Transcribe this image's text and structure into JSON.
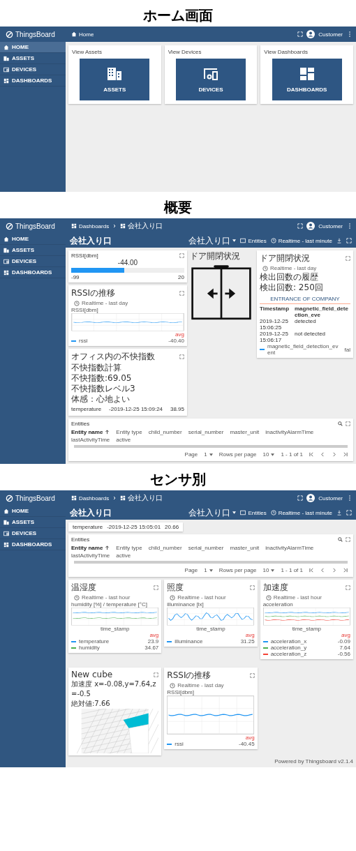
{
  "screens": [
    {
      "kind": "home",
      "heading": "ホーム画面",
      "logo": "ThingsBoard",
      "user": "Customer",
      "sidebar": [
        {
          "label": "HOME",
          "selected": true
        },
        {
          "label": "ASSETS",
          "selected": false
        },
        {
          "label": "DEVICES",
          "selected": false
        },
        {
          "label": "DASHBOARDS",
          "selected": false
        }
      ],
      "breadcrumbs": [
        "Home"
      ],
      "cards": [
        {
          "title": "View Assets",
          "button": "ASSETS"
        },
        {
          "title": "View Devices",
          "button": "DEVICES"
        },
        {
          "title": "View Dashboards",
          "button": "DASHBOARDS"
        }
      ]
    },
    {
      "kind": "overview",
      "heading": "概要",
      "logo": "ThingsBoard",
      "user": "Customer",
      "sidebar": [
        {
          "label": "HOME",
          "selected": false
        },
        {
          "label": "ASSETS",
          "selected": false
        },
        {
          "label": "DEVICES",
          "selected": false
        },
        {
          "label": "DASHBOARDS",
          "selected": false
        }
      ],
      "breadcrumbs": [
        "Dashboards",
        "会社入り口"
      ],
      "toolbar": {
        "title": "会社入り口",
        "state": "会社入り口",
        "entities": "Entities",
        "timewindow": "Realtime - last minute"
      },
      "gauge": {
        "title": "RSSI[dbm]",
        "value": "-44.00",
        "level": 0.47,
        "min": "-99",
        "max": "20"
      },
      "rssi_chart": {
        "title": "RSSIの推移",
        "timewindow": "Realtime - last day",
        "ylabel": "RSSI[dbm]",
        "legend_header": "avg",
        "legend": [
          {
            "name": "rssi",
            "value": "-40.40",
            "color": "#2196f3"
          }
        ]
      },
      "comfort": {
        "title": "オフィス内の不快指数",
        "lines": [
          "不快指数計算",
          "不快指数:69.05",
          "不快指数レベル3",
          "体感：心地よい"
        ],
        "row": [
          "temperature",
          "-2019-12-25 15:09:24",
          "38.95"
        ]
      },
      "door": {
        "title": "ドア開閉状況"
      },
      "door_status": {
        "title": "ドア開閉状況",
        "timewindow": "Realtime - last day",
        "lines": [
          "検出回数の履歴",
          "検出回数: 250回"
        ],
        "tab": "ENTRANCE OF COMPANY",
        "columns": [
          "Timestamp",
          "magnetic_field_detection_eve"
        ],
        "rows": [
          [
            "2019-12-25 15:06:25",
            "detected"
          ],
          [
            "2019-12-25 15:06:17",
            "not detected"
          ]
        ],
        "legend": "magnetic_field_detection_event",
        "legend_value": "fal"
      },
      "entities": {
        "title": "Entities",
        "columns": [
          "Entity name",
          "Entity type",
          "child_number",
          "serial_number",
          "master_unit",
          "inactivityAlarmTime",
          "lastActivityTime",
          "active"
        ],
        "page_label": "Page",
        "page": "1",
        "rows_label": "Rows per page",
        "rows": "10",
        "range": "1 - 1 of 1"
      }
    },
    {
      "kind": "sensors",
      "heading": "センサ別",
      "logo": "ThingsBoard",
      "user": "Customer",
      "sidebar": [
        {
          "label": "HOME",
          "selected": false
        },
        {
          "label": "ASSETS",
          "selected": false
        },
        {
          "label": "DEVICES",
          "selected": false
        },
        {
          "label": "DASHBOARDS",
          "selected": false
        }
      ],
      "breadcrumbs": [
        "Dashboards",
        "会社入り口"
      ],
      "toolbar": {
        "title": "会社入り口",
        "state": "会社入り口",
        "entities": "Entities",
        "timewindow": "Realtime - last minute"
      },
      "row": [
        "temperature",
        "-2019-12-25 15:05:01",
        "20.66"
      ],
      "entities": {
        "title": "Entities",
        "columns": [
          "Entity name",
          "Entity type",
          "child_number",
          "serial_number",
          "master_unit",
          "inactivityAlarmTime",
          "lastActivityTime",
          "active"
        ],
        "page_label": "Page",
        "page": "1",
        "rows_label": "Rows per page",
        "rows": "10",
        "range": "1 - 1 of 1"
      },
      "widgets": [
        {
          "kind": "chart",
          "title": "温湿度",
          "timewindow": "Realtime - last hour",
          "ylabel": "humidity [%] / temperature [°C]",
          "xlabel": "time_stamp",
          "legend_header": "avg",
          "legend": [
            {
              "name": "temperature",
              "value": "23.9",
              "color": "#2196f3"
            },
            {
              "name": "humidity",
              "value": "34.67",
              "color": "#4caf50"
            }
          ]
        },
        {
          "kind": "chart",
          "title": "照度",
          "timewindow": "Realtime - last hour",
          "ylabel": "illuminance [lx]",
          "xlabel": "time_stamp",
          "legend_header": "avg",
          "legend": [
            {
              "name": "illuminance",
              "value": "31.25",
              "color": "#2196f3"
            }
          ]
        },
        {
          "kind": "chart",
          "title": "加速度",
          "timewindow": "Realtime - last hour",
          "ylabel": "acceleration",
          "xlabel": "time_stamp",
          "legend_header": "avg",
          "legend": [
            {
              "name": "acceleration_x",
              "value": "-0.09",
              "color": "#2196f3"
            },
            {
              "name": "acceleration_y",
              "value": "7.64",
              "color": "#4caf50"
            },
            {
              "name": "acceleration_z",
              "value": "-0.56",
              "color": "#f44336"
            }
          ]
        },
        {
          "kind": "cube",
          "title": "New cube",
          "lines": [
            "加速度 x=-0.08,y=7.64,z=-0.5",
            "絶対値:7.66"
          ]
        },
        {
          "kind": "chart",
          "title": "RSSIの推移",
          "timewindow": "Realtime - last day",
          "ylabel": "RSSI[dbm]",
          "legend_header": "avg",
          "legend": [
            {
              "name": "rssi",
              "value": "-40.45",
              "color": "#2196f3"
            }
          ]
        }
      ],
      "footer": "Powered by Thingsboard v2.1.4"
    }
  ]
}
